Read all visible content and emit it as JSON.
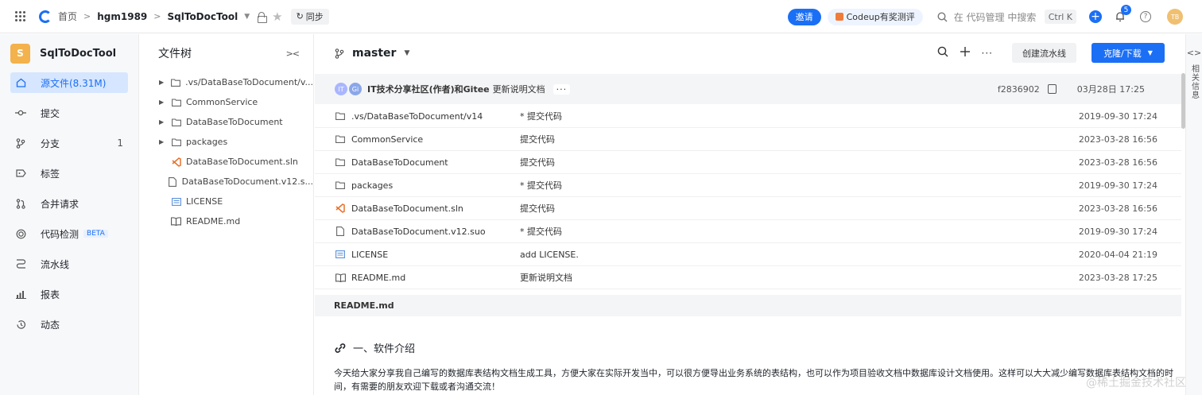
{
  "topbar": {
    "breadcrumb_home": "首页",
    "breadcrumb_owner": "hgm1989",
    "breadcrumb_repo": "SqlToDocTool",
    "sync_label": "同步",
    "invite_label": "邀请",
    "codeup_label": "Codeup有奖测评",
    "search_placeholder": "在 代码管理 中搜索",
    "shortcut": "Ctrl K",
    "notification_count": "5",
    "avatar_initials": "TB"
  },
  "sidebar": {
    "repo_initial": "S",
    "repo_name": "SqlToDocTool",
    "items": [
      {
        "label": "源文件(8.31M)",
        "icon": "home-icon",
        "active": true
      },
      {
        "label": "提交",
        "icon": "commit-icon"
      },
      {
        "label": "分支",
        "icon": "branch-icon",
        "count": "1"
      },
      {
        "label": "标签",
        "icon": "tag-icon"
      },
      {
        "label": "合并请求",
        "icon": "merge-icon"
      },
      {
        "label": "代码检测",
        "icon": "scan-icon",
        "badge": "BETA"
      },
      {
        "label": "流水线",
        "icon": "pipeline-icon"
      },
      {
        "label": "报表",
        "icon": "chart-icon"
      },
      {
        "label": "动态",
        "icon": "history-icon"
      }
    ]
  },
  "filetree": {
    "title": "文件树",
    "items": [
      {
        "name": ".vs/DataBaseToDocument/v...",
        "type": "folder"
      },
      {
        "name": "CommonService",
        "type": "folder"
      },
      {
        "name": "DataBaseToDocument",
        "type": "folder"
      },
      {
        "name": "packages",
        "type": "folder"
      },
      {
        "name": "DataBaseToDocument.sln",
        "type": "vs"
      },
      {
        "name": "DataBaseToDocument.v12.s...",
        "type": "file"
      },
      {
        "name": "LICENSE",
        "type": "license"
      },
      {
        "name": "README.md",
        "type": "book"
      }
    ]
  },
  "main": {
    "branch": "master",
    "pipeline_label": "创建流水线",
    "clone_label": "克隆/下载",
    "commit": {
      "avatar1": "IT",
      "avatar2": "Gi",
      "author": "IT技术分享社区(作者)和Gitee",
      "message": "更新说明文档",
      "more": "···",
      "hash": "f2836902",
      "date": "03月28日 17:25"
    },
    "files": [
      {
        "name": ".vs/DataBaseToDocument/v14",
        "msg": "* 提交代码",
        "date": "2019-09-30 17:24",
        "type": "folder"
      },
      {
        "name": "CommonService",
        "msg": "提交代码",
        "date": "2023-03-28 16:56",
        "type": "folder"
      },
      {
        "name": "DataBaseToDocument",
        "msg": "提交代码",
        "date": "2023-03-28 16:56",
        "type": "folder"
      },
      {
        "name": "packages",
        "msg": "* 提交代码",
        "date": "2019-09-30 17:24",
        "type": "folder"
      },
      {
        "name": "DataBaseToDocument.sln",
        "msg": "提交代码",
        "date": "2023-03-28 16:56",
        "type": "vs"
      },
      {
        "name": "DataBaseToDocument.v12.suo",
        "msg": "* 提交代码",
        "date": "2019-09-30 17:24",
        "type": "file"
      },
      {
        "name": "LICENSE",
        "msg": "add LICENSE.",
        "date": "2020-04-04 21:19",
        "type": "license"
      },
      {
        "name": "README.md",
        "msg": "更新说明文档",
        "date": "2023-03-28 17:25",
        "type": "book"
      }
    ],
    "readme_title": "README.md",
    "readme_heading": "一、软件介绍",
    "readme_paragraph": "今天给大家分享我自己编写的数据库表结构文档生成工具，方便大家在实际开发当中，可以很方便导出业务系统的表结构，也可以作为项目验收文档中数据库设计文档使用。这样可以大大减少编写数据库表结构文档的时间，有需要的朋友欢迎下载或者沟通交流！"
  },
  "rightpanel": {
    "label": "相关信息"
  },
  "watermark": "@稀土掘金技术社区",
  "colors": {
    "accent": "#1b6ff5",
    "active_bg": "#d6e6ff",
    "repo_avatar": "#f3b24b"
  }
}
